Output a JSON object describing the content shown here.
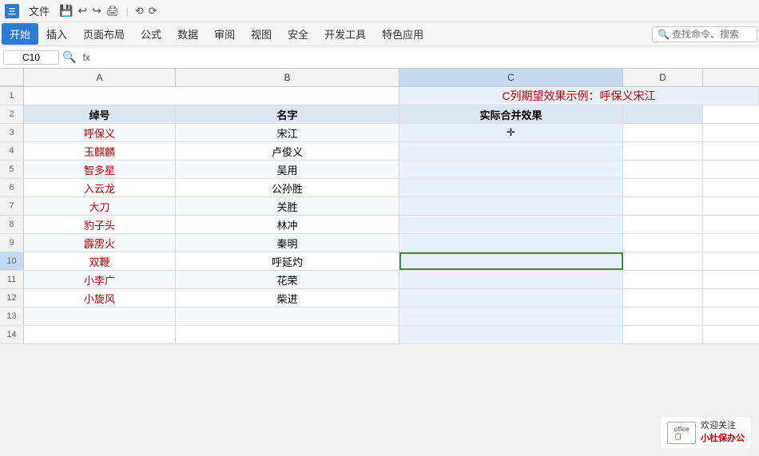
{
  "titlebar": {
    "file_label": "文件",
    "app_label": "三"
  },
  "menubar": {
    "items": [
      {
        "label": "开始",
        "active": true
      },
      {
        "label": "插入",
        "active": false
      },
      {
        "label": "页面布局",
        "active": false
      },
      {
        "label": "公式",
        "active": false
      },
      {
        "label": "数据",
        "active": false
      },
      {
        "label": "审阅",
        "active": false
      },
      {
        "label": "视图",
        "active": false
      },
      {
        "label": "安全",
        "active": false
      },
      {
        "label": "开发工具",
        "active": false
      },
      {
        "label": "特色应用",
        "active": false
      }
    ],
    "search_placeholder": "查找命令、搜索"
  },
  "formulabar": {
    "cell_ref": "C10",
    "fx_label": "fx"
  },
  "columns": {
    "headers": [
      "A",
      "B",
      "C",
      "D"
    ],
    "row_corner": ""
  },
  "title_row": {
    "text": "C列期望效果示例：呼保义宋江"
  },
  "header_row": {
    "col_a": "绰号",
    "col_b": "名字",
    "col_c": "实际合并效果"
  },
  "rows": [
    {
      "num": 3,
      "col_a": "呼保义",
      "col_b": "宋江",
      "col_c": "✛"
    },
    {
      "num": 4,
      "col_a": "玉麒麟",
      "col_b": "卢俊义",
      "col_c": ""
    },
    {
      "num": 5,
      "col_a": "智多星",
      "col_b": "吴用",
      "col_c": ""
    },
    {
      "num": 6,
      "col_a": "入云龙",
      "col_b": "公孙胜",
      "col_c": ""
    },
    {
      "num": 7,
      "col_a": "大刀",
      "col_b": "关胜",
      "col_c": ""
    },
    {
      "num": 8,
      "col_a": "豹子头",
      "col_b": "林冲",
      "col_c": ""
    },
    {
      "num": 9,
      "col_a": "霹雳火",
      "col_b": "秦明",
      "col_c": ""
    },
    {
      "num": 10,
      "col_a": "双鞭",
      "col_b": "呼延灼",
      "col_c": ""
    },
    {
      "num": 11,
      "col_a": "小李广",
      "col_b": "花荣",
      "col_c": ""
    },
    {
      "num": 12,
      "col_a": "小旋风",
      "col_b": "柴进",
      "col_c": ""
    },
    {
      "num": 13,
      "col_a": "",
      "col_b": "",
      "col_c": ""
    },
    {
      "num": 14,
      "col_a": "",
      "col_b": "",
      "col_c": ""
    }
  ],
  "watermark": {
    "follow_label": "欢迎关注",
    "name_label": "小杜保办公",
    "icon_text": "office"
  }
}
